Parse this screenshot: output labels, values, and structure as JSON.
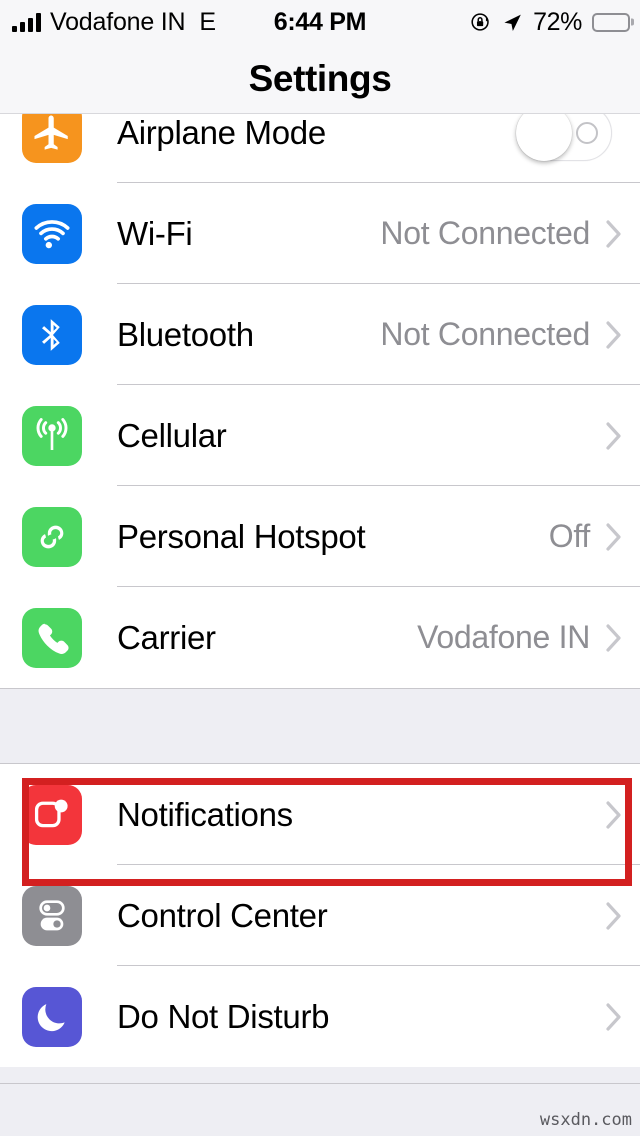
{
  "status_bar": {
    "signal_icon": "signal-bars-icon",
    "carrier": "Vodafone IN",
    "network_type": "E",
    "time": "6:44 PM",
    "rotation_lock_icon": "rotation-lock-icon",
    "location_icon": "location-arrow-icon",
    "battery_percent": "72%",
    "battery_level": 72,
    "battery_icon": "battery-icon"
  },
  "nav_bar": {
    "title": "Settings"
  },
  "groups": [
    {
      "id": "connectivity",
      "rows": [
        {
          "label": "Airplane Mode",
          "icon": "airplane-icon",
          "icon_color": "#F6941E",
          "accessory": "switch",
          "switch_on": false,
          "value": ""
        },
        {
          "label": "Wi-Fi",
          "icon": "wifi-icon",
          "icon_color": "#0A76EE",
          "accessory": "chevron",
          "value": "Not Connected"
        },
        {
          "label": "Bluetooth",
          "icon": "bluetooth-icon",
          "icon_color": "#0A76EE",
          "accessory": "chevron",
          "value": "Not Connected"
        },
        {
          "label": "Cellular",
          "icon": "cellular-antenna-icon",
          "icon_color": "#4CD662",
          "accessory": "chevron",
          "value": ""
        },
        {
          "label": "Personal Hotspot",
          "icon": "hotspot-link-icon",
          "icon_color": "#4CD662",
          "accessory": "chevron",
          "value": "Off"
        },
        {
          "label": "Carrier",
          "icon": "phone-handset-icon",
          "icon_color": "#4CD662",
          "accessory": "chevron",
          "value": "Vodafone IN"
        }
      ]
    },
    {
      "id": "alerts",
      "rows": [
        {
          "label": "Notifications",
          "icon": "notifications-badge-icon",
          "icon_color": "#F3353B",
          "accessory": "chevron",
          "value": "",
          "highlighted": true
        },
        {
          "label": "Control Center",
          "icon": "control-center-toggles-icon",
          "icon_color": "#8E8E93",
          "accessory": "chevron",
          "value": ""
        },
        {
          "label": "Do Not Disturb",
          "icon": "moon-icon",
          "icon_color": "#5756D5",
          "accessory": "chevron",
          "value": ""
        }
      ]
    }
  ],
  "annotation": {
    "type": "highlight-rectangle",
    "target": "Notifications",
    "color": "#D32020"
  },
  "footer": {
    "watermark": "wsxdn.com"
  }
}
